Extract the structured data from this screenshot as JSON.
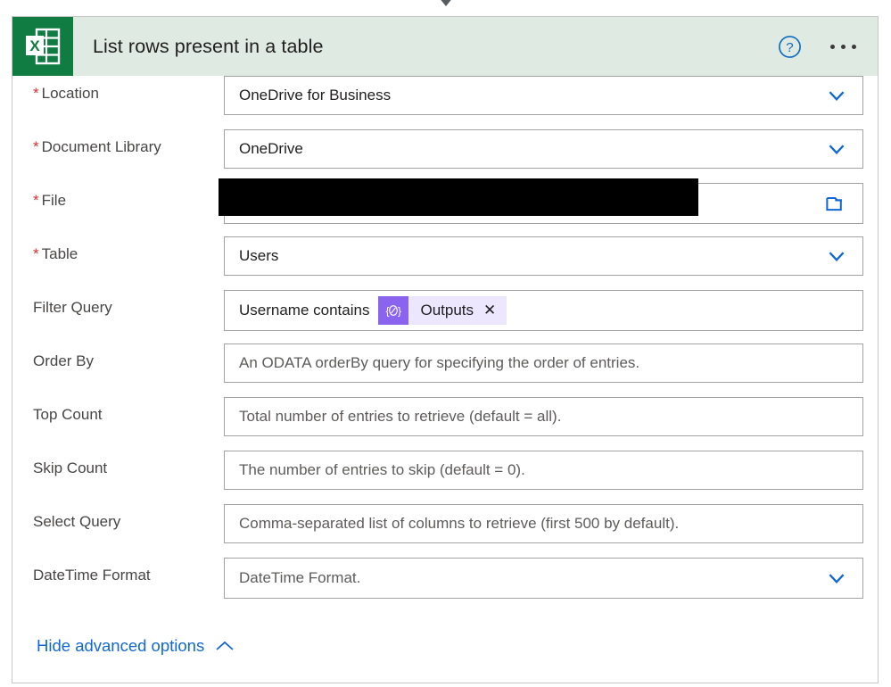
{
  "connector": {
    "icon": "arrow-down-icon"
  },
  "card": {
    "header": {
      "app_icon": "excel-icon",
      "title": "List rows present in a table",
      "help_icon": "help-circle-icon",
      "more_icon": "ellipsis-icon",
      "background_color": "#dfeae2",
      "icon_color": "#107c41"
    },
    "fields": [
      {
        "label": "Location",
        "required": true,
        "type": "dropdown",
        "value": "OneDrive for Business",
        "placeholder": "",
        "icon": "chevron-down-icon"
      },
      {
        "label": "Document Library",
        "required": true,
        "type": "dropdown",
        "value": "OneDrive",
        "placeholder": "",
        "icon": "chevron-down-icon"
      },
      {
        "label": "File",
        "required": true,
        "type": "file-picker",
        "value": "",
        "placeholder": "",
        "icon": "folder-icon",
        "redacted": true
      },
      {
        "label": "Table",
        "required": true,
        "type": "dropdown",
        "value": "Users",
        "placeholder": "",
        "icon": "chevron-down-icon"
      },
      {
        "label": "Filter Query",
        "required": false,
        "type": "token-text",
        "value": "Username contains",
        "placeholder": "",
        "token": {
          "badge_icon": "expression-icon",
          "label": "Outputs",
          "close_icon": "close-icon",
          "badge_color": "#8a64ee",
          "pill_color": "#ece6ff"
        }
      },
      {
        "label": "Order By",
        "required": false,
        "type": "text",
        "value": "",
        "placeholder": "An ODATA orderBy query for specifying the order of entries."
      },
      {
        "label": "Top Count",
        "required": false,
        "type": "text",
        "value": "",
        "placeholder": "Total number of entries to retrieve (default = all)."
      },
      {
        "label": "Skip Count",
        "required": false,
        "type": "text",
        "value": "",
        "placeholder": "The number of entries to skip (default = 0)."
      },
      {
        "label": "Select Query",
        "required": false,
        "type": "text",
        "value": "",
        "placeholder": "Comma-separated list of columns to retrieve (first 500 by default)."
      },
      {
        "label": "DateTime Format",
        "required": false,
        "type": "dropdown",
        "value": "",
        "placeholder": "DateTime Format.",
        "icon": "chevron-down-icon"
      }
    ],
    "advanced_options": {
      "label": "Hide advanced options",
      "icon": "chevron-up-icon",
      "color": "#1268d2"
    }
  }
}
